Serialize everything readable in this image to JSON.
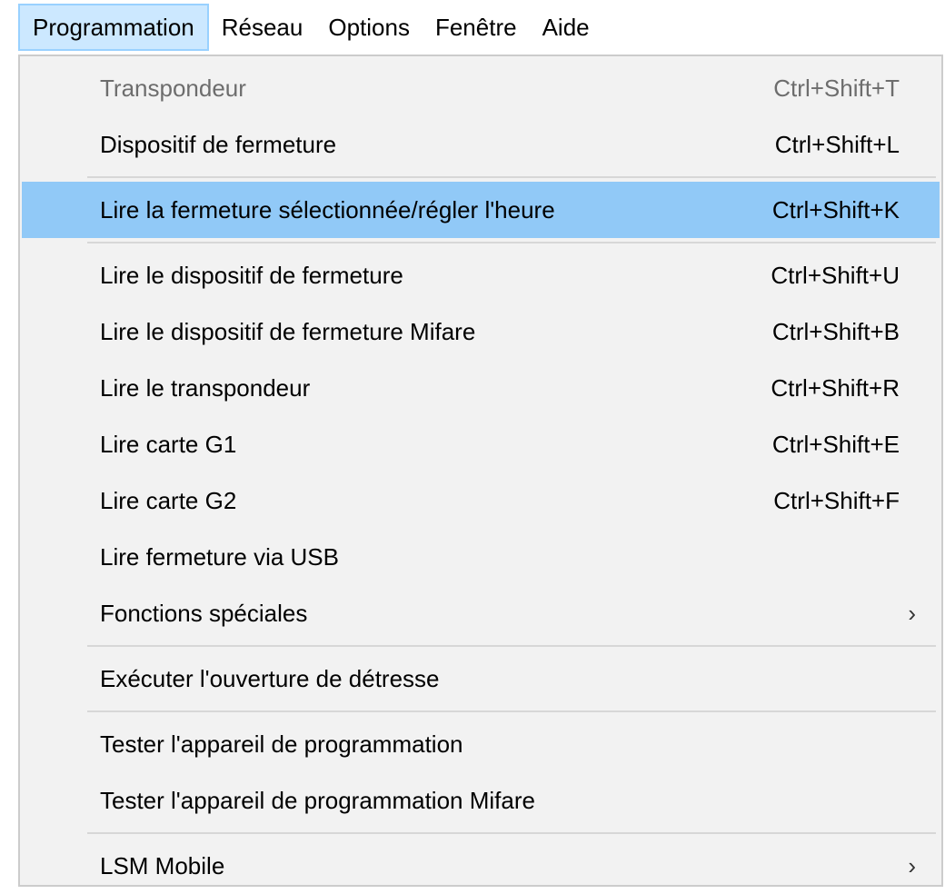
{
  "menubar": {
    "items": [
      {
        "label": "Programmation"
      },
      {
        "label": "Réseau"
      },
      {
        "label": "Options"
      },
      {
        "label": "Fenêtre"
      },
      {
        "label": "Aide"
      }
    ]
  },
  "menu": {
    "transpondeur": {
      "label": "Transpondeur",
      "shortcut": "Ctrl+Shift+T"
    },
    "dispositif_fermeture": {
      "label": "Dispositif de fermeture",
      "shortcut": "Ctrl+Shift+L"
    },
    "lire_fermeture_selectionnee": {
      "label": "Lire la fermeture sélectionnée/régler l'heure",
      "shortcut": "Ctrl+Shift+K"
    },
    "lire_dispositif": {
      "label": "Lire le dispositif de fermeture",
      "shortcut": "Ctrl+Shift+U"
    },
    "lire_dispositif_mifare": {
      "label": "Lire le dispositif de fermeture Mifare",
      "shortcut": "Ctrl+Shift+B"
    },
    "lire_transpondeur": {
      "label": "Lire le transpondeur",
      "shortcut": "Ctrl+Shift+R"
    },
    "lire_carte_g1": {
      "label": "Lire carte G1",
      "shortcut": "Ctrl+Shift+E"
    },
    "lire_carte_g2": {
      "label": "Lire carte G2",
      "shortcut": "Ctrl+Shift+F"
    },
    "lire_fermeture_usb": {
      "label": "Lire fermeture via USB"
    },
    "fonctions_speciales": {
      "label": "Fonctions spéciales",
      "arrow": "›"
    },
    "ouverture_detresse": {
      "label": "Exécuter l'ouverture de détresse"
    },
    "tester_appareil": {
      "label": "Tester l'appareil de programmation"
    },
    "tester_appareil_mifare": {
      "label": "Tester l'appareil de programmation Mifare"
    },
    "lsm_mobile": {
      "label": "LSM Mobile",
      "arrow": "›"
    }
  },
  "colors": {
    "menubar_open_bg": "#cce8ff",
    "menubar_open_border": "#99d1ff",
    "dropdown_bg": "#f2f2f2",
    "highlight": "#91c9f7",
    "disabled_text": "#6d6d6d"
  }
}
